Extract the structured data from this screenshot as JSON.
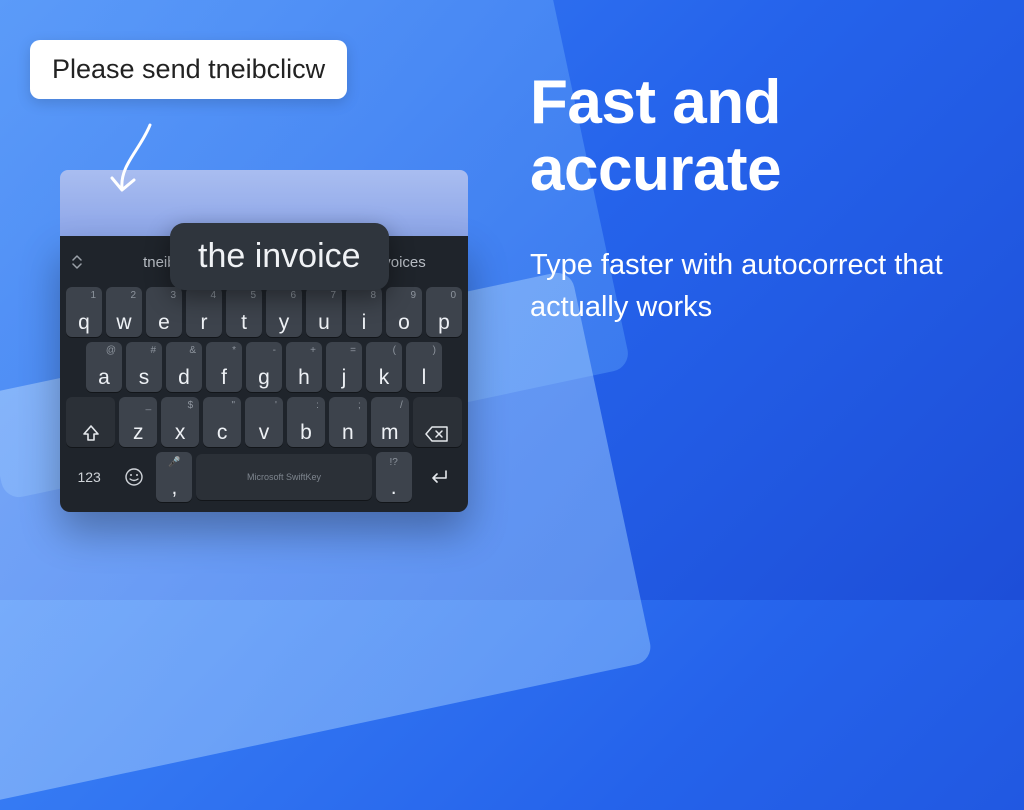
{
  "bubble_text": "Please send tneibclicw",
  "popup_suggestion": "the invoice",
  "suggestions": {
    "left": "tneib",
    "right": "invoices"
  },
  "keyboard": {
    "row1": [
      {
        "m": "q",
        "s": "1"
      },
      {
        "m": "w",
        "s": "2"
      },
      {
        "m": "e",
        "s": "3"
      },
      {
        "m": "r",
        "s": "4"
      },
      {
        "m": "t",
        "s": "5"
      },
      {
        "m": "y",
        "s": "6"
      },
      {
        "m": "u",
        "s": "7"
      },
      {
        "m": "i",
        "s": "8"
      },
      {
        "m": "o",
        "s": "9"
      },
      {
        "m": "p",
        "s": "0"
      }
    ],
    "row2": [
      {
        "m": "a",
        "s": "@"
      },
      {
        "m": "s",
        "s": "#"
      },
      {
        "m": "d",
        "s": "&"
      },
      {
        "m": "f",
        "s": "*"
      },
      {
        "m": "g",
        "s": "-"
      },
      {
        "m": "h",
        "s": "+"
      },
      {
        "m": "j",
        "s": "="
      },
      {
        "m": "k",
        "s": "("
      },
      {
        "m": "l",
        "s": ")"
      }
    ],
    "row3": [
      {
        "m": "z",
        "s": "_"
      },
      {
        "m": "x",
        "s": "$"
      },
      {
        "m": "c",
        "s": "\""
      },
      {
        "m": "v",
        "s": "'"
      },
      {
        "m": "b",
        "s": ":"
      },
      {
        "m": "n",
        "s": ";"
      },
      {
        "m": "m",
        "s": "/"
      }
    ],
    "numeric_label": "123",
    "comma": {
      "m": ",",
      "s": "🎤"
    },
    "dot": {
      "m": ".",
      "s": "!?"
    },
    "space_label": "Microsoft SwiftKey"
  },
  "headline": "Fast and accurate",
  "subtext": "Type faster with autocorrect that actually works"
}
